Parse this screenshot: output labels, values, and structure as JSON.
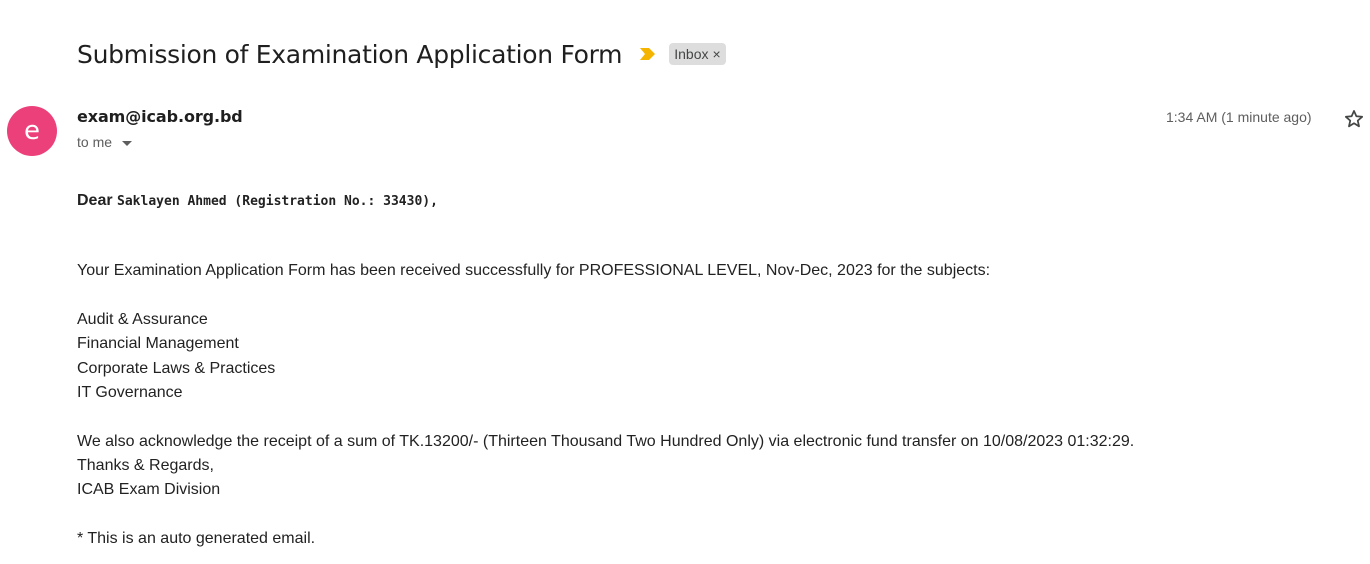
{
  "email": {
    "subject": "Submission of Examination Application Form",
    "label": "Inbox",
    "label_close": "×",
    "sender_initial": "e",
    "sender": "exam@icab.org.bd",
    "recipient": "to me",
    "timestamp": "1:34 AM (1 minute ago)"
  },
  "body": {
    "greeting_word": "Dear",
    "greeting_name": "Saklayen Ahmed (Registration No.: 33430),",
    "intro": "Your Examination Application Form has been received successfully for PROFESSIONAL LEVEL, Nov-Dec, 2023 for the subjects:",
    "subjects": [
      "Audit & Assurance",
      "Financial Management",
      "Corporate Laws & Practices",
      "IT Governance"
    ],
    "acknowledgement": "We also acknowledge the receipt of a sum of TK.13200/- (Thirteen Thousand Two Hundred Only) via electronic fund transfer on 10/08/2023 01:32:29.",
    "thanks": "Thanks & Regards,",
    "signature": "ICAB Exam Division",
    "footnote": "* This is an auto generated email."
  },
  "colors": {
    "avatar": "#ec407a",
    "important_marker": "#f4b400",
    "label_chip": "#dddddd"
  },
  "icons": {
    "important": "important-marker-icon",
    "star": "star-icon",
    "dropdown": "chevron-down-icon"
  }
}
